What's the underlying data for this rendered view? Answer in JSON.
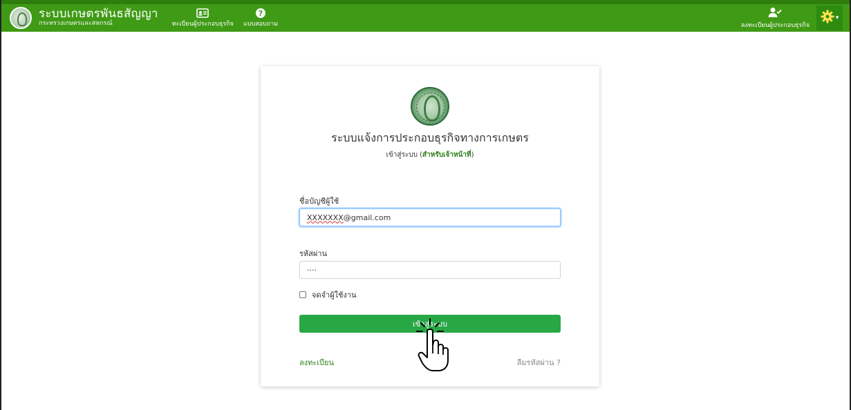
{
  "header": {
    "brand_title": "ระบบเกษตรพันธสัญญา",
    "brand_subtitle": "กระทรวงเกษตรและสหกรณ์",
    "nav": [
      {
        "label": "ทะเบียนผู้ประกอบธุรกิจ",
        "icon": "id-card-icon"
      },
      {
        "label": "แบบสอบถาม",
        "icon": "question-circle-icon"
      }
    ],
    "register_label": "ลงทะเบียนผู้ประกอบธุรกิจ",
    "register_icon": "user-check-icon",
    "settings_icon": "gear-icon",
    "settings_caret": "▾"
  },
  "login": {
    "title": "ระบบแจ้งการประกอบธุรกิจทางการเกษตร",
    "subtitle_prefix": "เข้าสู่ระบบ (",
    "subtitle_highlight": "สำหรับเจ้าหน้าที่",
    "subtitle_suffix": ")",
    "username_label": "ชื่อบัญชีผู้ใช้",
    "username_value_marked": "XXXXXXX",
    "username_value_rest": "@gmail.com",
    "password_label": "รหัสผ่าน",
    "password_value": "····",
    "remember_label": "จดจำผู้ใช้งาน",
    "login_button": "เข้าสู่ระบบ",
    "register_link": "ลงทะเบียน",
    "forgot_link": "ลืมรหัสผ่าน ?"
  },
  "colors": {
    "navbar": "#3f9a15",
    "accent": "#28a745",
    "link": "#2b7d16"
  }
}
